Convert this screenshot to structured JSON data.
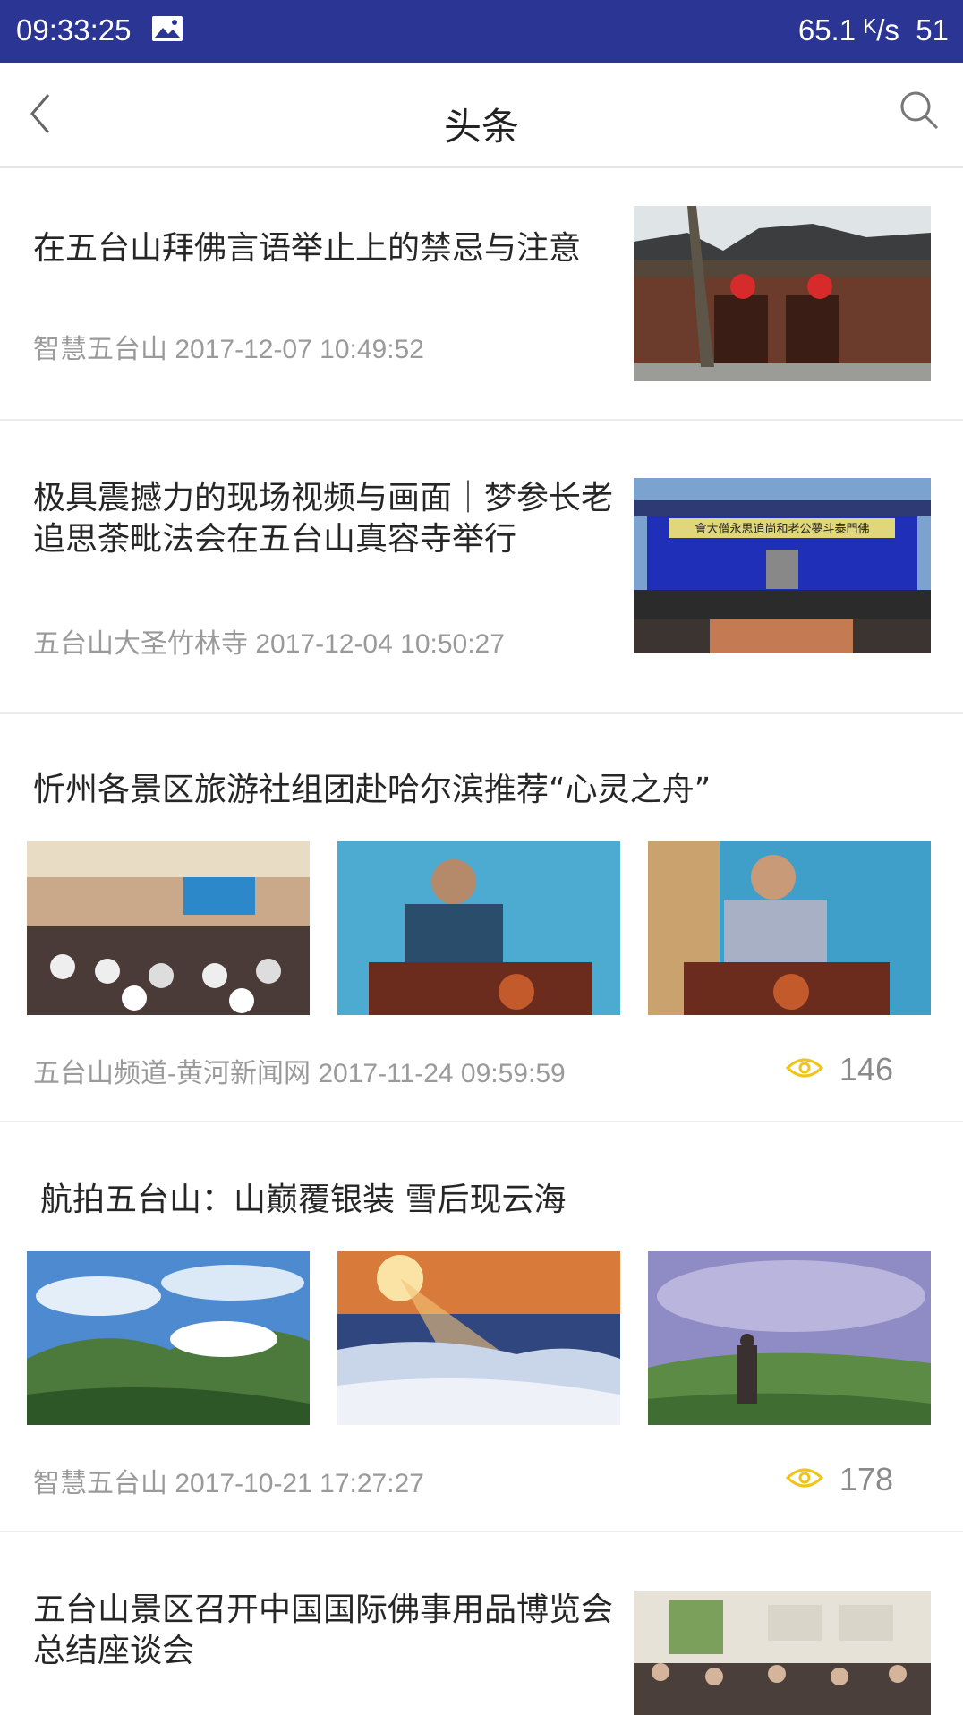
{
  "status_bar": {
    "time": "09:33:25",
    "net_speed": "65.1 ᴷ/s",
    "battery": "51"
  },
  "header": {
    "title": "头条"
  },
  "articles": [
    {
      "title": "在五台山拜佛言语举止上的禁忌与注意",
      "source": "智慧五台山",
      "date": "2017-12-07 10:49:52"
    },
    {
      "title": "极具震撼力的现场视频与画面｜梦参长老追思荼毗法会在五台山真容寺举行",
      "source": "五台山大圣竹林寺",
      "date": "2017-12-04 10:50:27",
      "banner_text": "會大僧永思追尚和老公夢斗泰門佛"
    },
    {
      "title": "忻州各景区旅游社组团赴哈尔滨推荐“心灵之舟”",
      "source": "五台山频道-黄河新闻网",
      "date": "2017-11-24 09:59:59",
      "views": "146"
    },
    {
      "title": "航拍五台山：山巅覆银装 雪后现云海",
      "source": "智慧五台山",
      "date": "2017-10-21 17:27:27",
      "views": "178"
    },
    {
      "title": "五台山景区召开中国国际佛事用品博览会总结座谈会"
    }
  ],
  "colors": {
    "status_bar": "#2b3593",
    "eye_icon": "#f0c419",
    "meta_text": "#9a9a9a"
  }
}
